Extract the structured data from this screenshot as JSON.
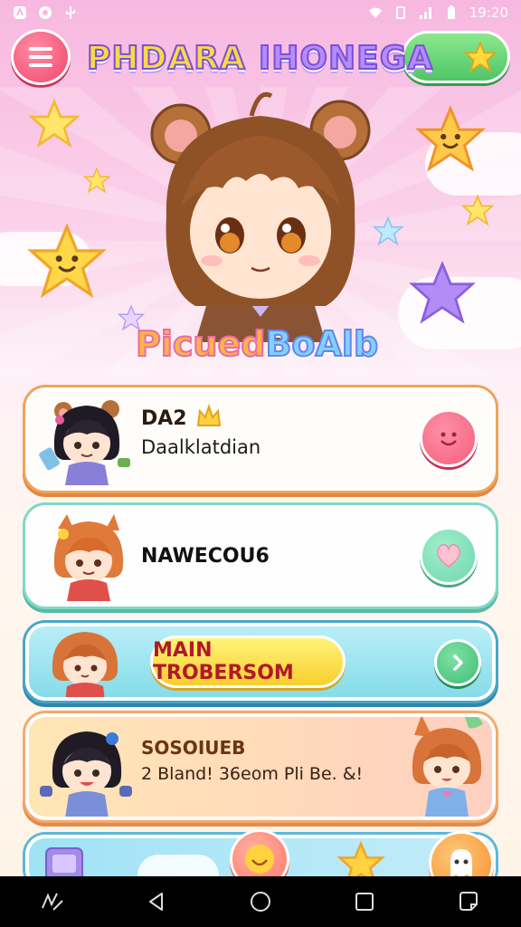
{
  "status_bar": {
    "time": "19:20",
    "left_icons": [
      "notification-a-icon",
      "notification-b-icon",
      "usb-icon"
    ],
    "right_icons": [
      "wifi-icon",
      "vibrate-icon",
      "signal-icon",
      "battery-icon"
    ]
  },
  "header": {
    "title_part1": "PHDARA",
    "title_part2": "IHONEGA",
    "menu_icon": "hamburger-icon",
    "right_button_icon": "star-icon"
  },
  "hero": {
    "badge_part1": "Picued",
    "badge_part2": "BoAlb"
  },
  "cards": [
    {
      "title": "DA2",
      "subtitle": "Daalklatdian",
      "title_icon": "crown-icon",
      "button_icon": "smile-icon",
      "button_color": "#f2607f"
    },
    {
      "title": "NAWECOU6",
      "button_icon": "heart-icon",
      "button_color": "#6fd6ad"
    },
    {
      "button_label": "MAIN TROBERSOM",
      "button_icon": "chevron-right-icon",
      "button_color": "#3fbf78"
    },
    {
      "title": "SOSOIUEB",
      "subtitle": "2 Bland! 36eom Pli Be. &!"
    }
  ],
  "colors": {
    "accent_pink": "#f0446b",
    "accent_green": "#4fc667",
    "accent_yellow": "#f8cf2e",
    "accent_purple": "#7b4fd4"
  },
  "nav_bar": {
    "icons": [
      "gesture-icon",
      "back-icon",
      "home-icon",
      "recents-icon",
      "screenshot-icon"
    ]
  }
}
